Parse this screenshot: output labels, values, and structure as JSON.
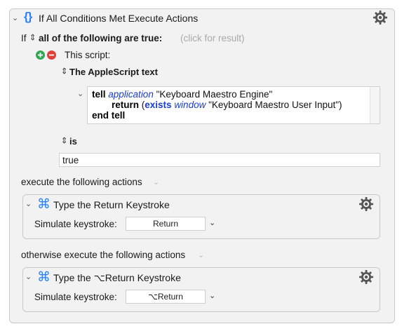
{
  "if_action": {
    "title": "If All Conditions Met Execute Actions",
    "braces_glyph": "{}",
    "if_label": "If",
    "condition_mode": "all of the following are true:",
    "result_hint": "(click for result)",
    "condition": {
      "type_label": "This script:",
      "script_kind": "The AppleScript text",
      "script_lines": {
        "l1_kw": "tell",
        "l1_class": "application",
        "l1_str": " \"Keyboard Maestro Engine\"",
        "l2_kw": "return",
        "l2_paren": " (",
        "l2_cmd": "exists",
        "l2_class": "window",
        "l2_str": " \"Keyboard Maestro User Input\")",
        "l3_kw": "end tell"
      },
      "comparison": "is",
      "result_value": "true"
    },
    "then_label": "execute the following actions",
    "then_action": {
      "title": "Type the Return Keystroke",
      "field_label": "Simulate keystroke:",
      "key_value": "Return"
    },
    "else_label": "otherwise execute the following actions",
    "else_action": {
      "title": "Type the ⌥Return Keystroke",
      "field_label": "Simulate keystroke:",
      "key_value": "⌥Return"
    }
  },
  "colors": {
    "braces_blue": "#2d7ff9",
    "cmd_blue": "#2d7ff9",
    "add_green": "#2fa84f",
    "remove_red": "#e0403a",
    "class_blue": "#1a3ccf"
  },
  "icons": {
    "disclosure": "chevron-down-icon",
    "gear": "gear-icon",
    "command": "command-key-icon",
    "add": "plus-circle-icon",
    "remove": "minus-circle-icon",
    "stepper": "up-down-stepper-icon"
  }
}
